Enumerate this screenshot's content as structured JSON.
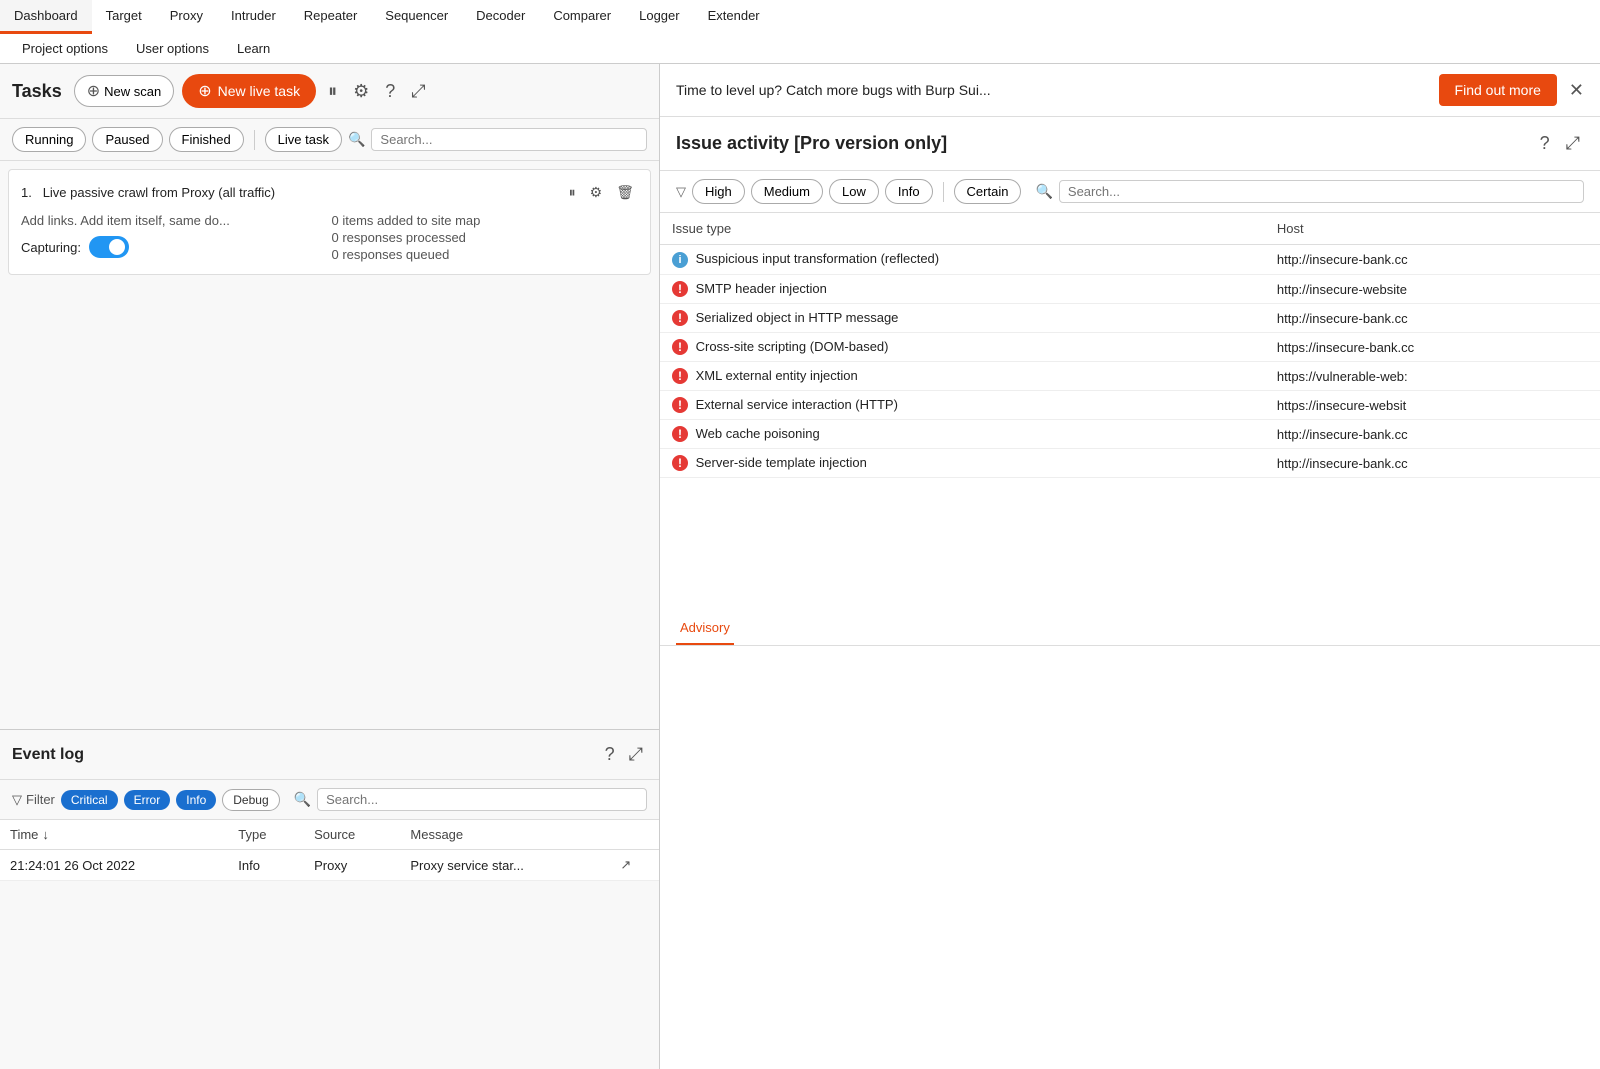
{
  "nav": {
    "row1": [
      "Dashboard",
      "Target",
      "Proxy",
      "Intruder",
      "Repeater",
      "Sequencer",
      "Decoder",
      "Comparer",
      "Logger",
      "Extender"
    ],
    "row1_active": "Dashboard",
    "row2": [
      "Project options",
      "User options",
      "Learn"
    ]
  },
  "tasks": {
    "title": "Tasks",
    "btn_new_scan": "New scan",
    "btn_new_live": "New live task",
    "filters": [
      "Running",
      "Paused",
      "Finished"
    ],
    "filter_live": "Live task",
    "search_placeholder": "Search...",
    "task1": {
      "number": "1.",
      "name": "Live passive crawl from Proxy (all traffic)",
      "description": "Add links. Add item itself, same do...",
      "stat1": "0 items added to site map",
      "stat2": "0 responses processed",
      "stat3": "0 responses queued",
      "capturing_label": "Capturing:"
    }
  },
  "event_log": {
    "title": "Event log",
    "filter_label": "Filter",
    "badges": [
      "Critical",
      "Error",
      "Info",
      "Debug"
    ],
    "search_placeholder": "Search...",
    "columns": [
      "Time",
      "Type",
      "Source",
      "Message"
    ],
    "rows": [
      {
        "time": "21:24:01 26 Oct 2022",
        "type": "Info",
        "source": "Proxy",
        "message": "Proxy service star..."
      }
    ]
  },
  "promo": {
    "text": "Time to level up? Catch more bugs with Burp Sui...",
    "btn_label": "Find out more"
  },
  "issue_activity": {
    "title": "Issue activity [Pro version only]",
    "severity_filters": [
      "High",
      "Medium",
      "Low",
      "Info"
    ],
    "confidence_filters": [
      "Certain"
    ],
    "search_placeholder": "Search...",
    "columns": [
      "Issue type",
      "Host"
    ],
    "issues": [
      {
        "icon": "info",
        "name": "Suspicious input transformation (reflected)",
        "host": "http://insecure-bank.cc"
      },
      {
        "icon": "high",
        "name": "SMTP header injection",
        "host": "http://insecure-website"
      },
      {
        "icon": "high",
        "name": "Serialized object in HTTP message",
        "host": "http://insecure-bank.cc"
      },
      {
        "icon": "high",
        "name": "Cross-site scripting (DOM-based)",
        "host": "https://insecure-bank.cc"
      },
      {
        "icon": "high",
        "name": "XML external entity injection",
        "host": "https://vulnerable-web:"
      },
      {
        "icon": "high",
        "name": "External service interaction (HTTP)",
        "host": "https://insecure-websit"
      },
      {
        "icon": "high",
        "name": "Web cache poisoning",
        "host": "http://insecure-bank.cc"
      },
      {
        "icon": "high",
        "name": "Server-side template injection",
        "host": "http://insecure-bank.cc"
      }
    ],
    "advisory_tab": "Advisory"
  }
}
